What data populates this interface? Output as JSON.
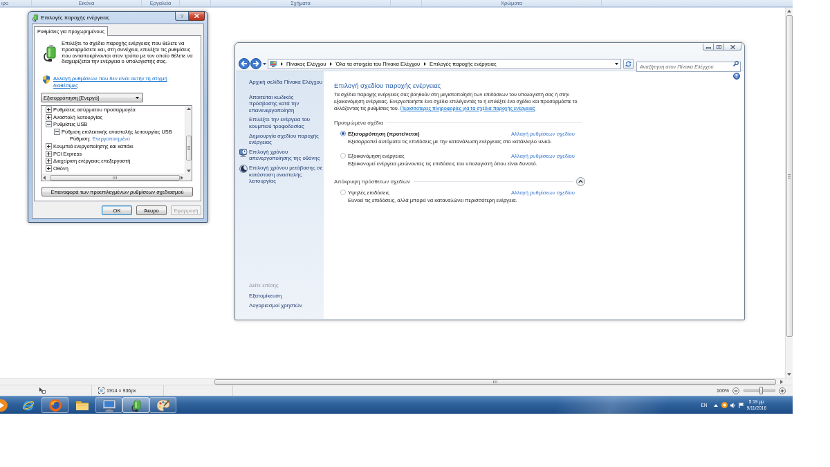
{
  "paint": {
    "ribbon_groups": [
      "ιρο",
      "Εικόνα",
      "Εργαλεία",
      "Σχήματα",
      "Χρώματα"
    ],
    "status_bar": {
      "image_size": "1914 × 936px",
      "zoom": "100%",
      "zoom_slider": {
        "level": 0.55
      }
    }
  },
  "power_dialog": {
    "title": "Επιλογές παροχής ενέργειας",
    "help_button": "?",
    "tabs": [
      {
        "label": "Ρυθμίσεις για προχωρημένους",
        "selected": true
      }
    ],
    "intro": "Επιλέξτε το σχέδιο παροχής ενέργειας που θέλετε να προσαρμόσετε και, στη συνέχεια, επιλέξτε τις ρυθμίσεις που ανταποκρίνονται στον τρόπο με τον οποίο θέλετε να διαχειρίζεται την ενέργεια ο υπολογιστής σας.",
    "admin_link": "Αλλαγή ρυθμίσεων που δεν είναι αυτήν τη στιγμή διαθέσιμες",
    "plan_select": {
      "value": "Εξισορρόπηση [Ενεργό]"
    },
    "settings_tree": [
      {
        "kind": "category",
        "label": "Ρυθμίσεις ασύρματου προσαρμογέα",
        "expanded": false
      },
      {
        "kind": "category",
        "label": "Αναστολή λειτουργίας",
        "expanded": false
      },
      {
        "kind": "category",
        "label": "Ρυθμίσεις USB",
        "expanded": true,
        "children": [
          {
            "kind": "category",
            "label": "Ρύθμιση επιλεκτικής αναστολής λειτουργίας USB",
            "expanded": true,
            "children": [
              {
                "kind": "setting",
                "label": "Ρύθμιση:",
                "value": "Ενεργοποιημένο"
              }
            ]
          }
        ]
      },
      {
        "kind": "category",
        "label": "Κουμπιά ενεργοποίησης και καπάκι",
        "expanded": false
      },
      {
        "kind": "category",
        "label": "PCI Express",
        "expanded": false
      },
      {
        "kind": "category",
        "label": "Διαχείριση ενέργειας επεξεργαστή",
        "expanded": false
      },
      {
        "kind": "category",
        "label": "Οθόνη",
        "expanded": false
      }
    ],
    "restore_button": "Επαναφορά των προεπιλεγμένων ρυθμίσεων σχεδιασμού",
    "buttons": [
      {
        "label": "OK",
        "default": true,
        "disabled": false
      },
      {
        "label": "Άκυρο",
        "default": false,
        "disabled": false
      },
      {
        "label": "Εφαρμογή",
        "default": false,
        "disabled": true
      }
    ]
  },
  "control_panel": {
    "breadcrumbs": [
      "Πίνακας Ελέγχου",
      "Όλα τα στοιχεία του Πίνακα Ελέγχου",
      "Επιλογές παροχής ενέργειας"
    ],
    "search": {
      "placeholder": "Αναζήτηση στον Πίνακα Ελέγχου"
    },
    "help_button": "?",
    "sidebar": {
      "items": [
        {
          "kind": "plain",
          "label": "Αρχική σελίδα Πίνακα Ελέγχου"
        },
        {
          "kind": "plain",
          "label": "Απαιτείται κωδικός πρόσβασης κατά την επανενεργοποίηση"
        },
        {
          "kind": "plain",
          "label": "Επιλέξτε την ενέργεια του κουμπιού τροφοδοσίας"
        },
        {
          "kind": "plain",
          "label": "Δημιουργία σχεδίου παροχής ενέργειας"
        },
        {
          "kind": "display",
          "label": "Επιλογή χρόνου απενεργοποίησης της οθόνης"
        },
        {
          "kind": "sleep",
          "label": "Επιλογή χρόνου μετάβασης σε κατάσταση αναστολής λειτουργίας"
        }
      ],
      "see_also_heading": "Δείτε επίσης",
      "see_also": [
        "Εξατομίκευση",
        "Λογαριασμοί χρηστών"
      ]
    },
    "title": "Επιλογή σχεδίου παροχής ενέργειας",
    "description": "Τα σχέδια παροχής ενέργειας σας βοηθούν στη μεγιστοποίηση των επιδόσεων του υπολογιστή σας ή στην εξοικονόμηση ενέργειας. Ενεργοποιήστε ένα σχέδιο επιλέγοντάς το ή επιλέξτε ένα σχέδιο και προσαρμόστε το αλλάζοντας τις ρυθμίσεις του.",
    "more_info_link": "Περισσότερες πληροφορίες για τα σχέδια παροχής ενέργειας",
    "plan_groups": [
      {
        "kind": "fixed",
        "heading": "Προτιμώμενα σχέδια",
        "expanded": true,
        "plans": [
          {
            "name": "Εξισορρόπηση (προτείνεται)",
            "selected": true,
            "description": "Εξισορροπεί αυτόματα τις επιδόσεις με την κατανάλωση ενέργειας στο κατάλληλο υλικό.",
            "link": "Αλλαγή ρυθμίσεων σχεδίου"
          },
          {
            "name": "Εξοικονόμηση ενέργειας",
            "selected": false,
            "description": "Εξοικονομεί ενέργεια μειώνοντας τις επιδόσεις του υπολογιστή όπου είναι δυνατό.",
            "link": "Αλλαγή ρυθμίσεων σχεδίου"
          }
        ]
      },
      {
        "kind": "collapsible",
        "heading": "Απόκρυψη πρόσθετων σχεδίων",
        "expanded": true,
        "plans": [
          {
            "name": "Υψηλές επιδόσεις",
            "selected": false,
            "description": "Ευνοεί τις επιδόσεις, αλλά μπορεί να καταναλώνει περισσότερη ενέργεια.",
            "link": "Αλλαγή ρυθμίσεων σχεδίου"
          }
        ]
      }
    ]
  },
  "taskbar": {
    "buttons": [
      {
        "kind": "player",
        "running": false,
        "selected": false
      },
      {
        "kind": "ring",
        "running": false,
        "selected": false
      },
      {
        "kind": "globe",
        "running": true,
        "selected": false
      },
      {
        "kind": "folder",
        "running": false,
        "selected": false
      },
      {
        "kind": "screen",
        "running": true,
        "selected": false
      },
      {
        "kind": "battery",
        "running": true,
        "selected": true
      },
      {
        "kind": "palette",
        "running": true,
        "selected": false
      }
    ],
    "language": "EN",
    "time": "5:19 μμ",
    "date": "9/11/2016"
  }
}
